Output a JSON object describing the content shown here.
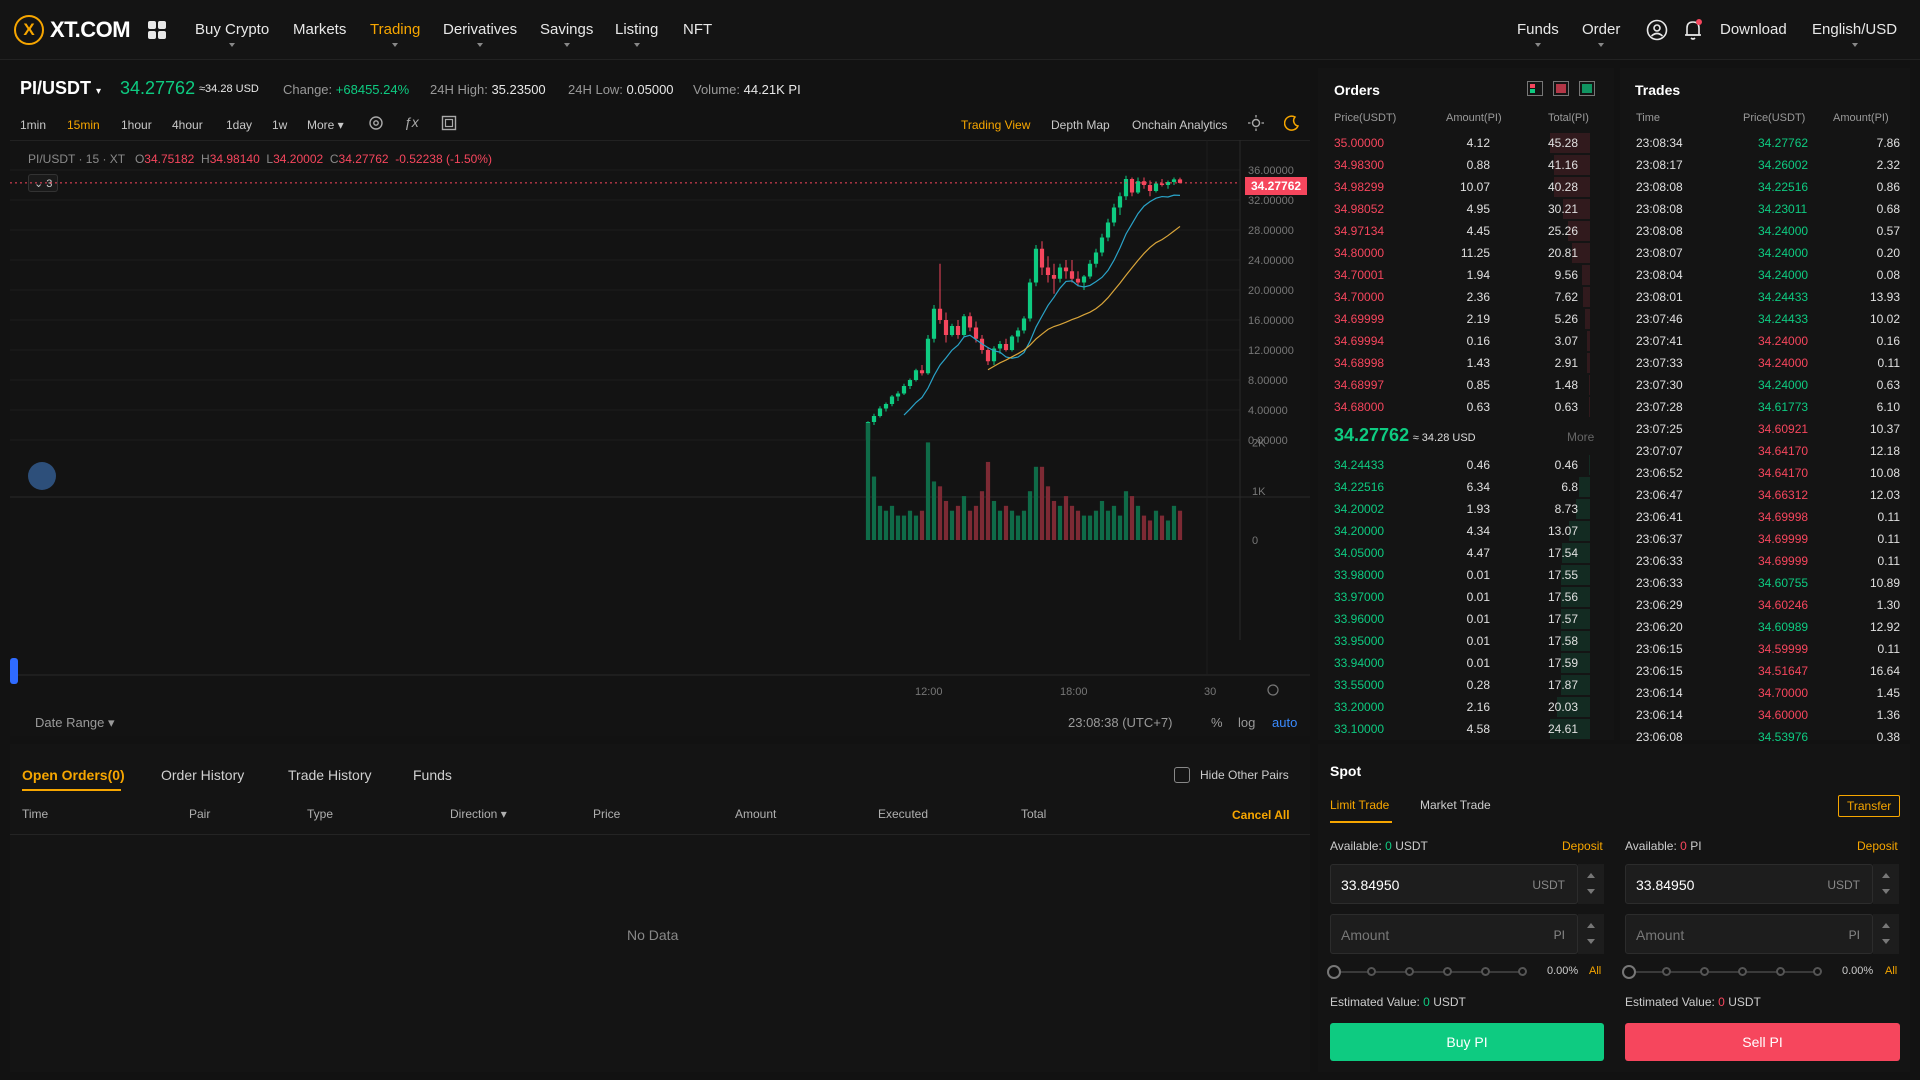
{
  "brand": {
    "logo_text": "XT.COM",
    "logo_mark": "X"
  },
  "nav": {
    "items": [
      "Buy Crypto",
      "Markets",
      "Trading",
      "Derivatives",
      "Savings",
      "Listing",
      "NFT"
    ],
    "right": {
      "funds": "Funds",
      "order": "Order",
      "download": "Download",
      "language": "English/USD"
    }
  },
  "ticker": {
    "pair": "PI/USDT",
    "price": "34.27762",
    "price_usd": "≈34.28 USD",
    "change_label": "Change:",
    "change_value": "+68455.24%",
    "high_label": "24H High:",
    "high_value": "35.23500",
    "low_label": "24H Low:",
    "low_value": "0.05000",
    "volume_label": "Volume:",
    "volume_value": "44.21K PI"
  },
  "timeframes": [
    "1min",
    "15min",
    "1hour",
    "4hour",
    "1day",
    "1w",
    "More"
  ],
  "active_timeframe": "15min",
  "views": [
    "Trading View",
    "Depth Map",
    "Onchain Analytics"
  ],
  "active_view": "Trading View",
  "chart_legend": {
    "symbol": "PI/USDT · 15 · XT",
    "o_label": "O",
    "o": "34.75182",
    "h_label": "H",
    "h": "34.98140",
    "l_label": "L",
    "l": "34.20002",
    "c_label": "C",
    "c": "34.27762",
    "chg": "-0.52238 (-1.50%)",
    "indicator_count": "3",
    "last_price_tag": "34.27762"
  },
  "chart_data": {
    "type": "candlestick",
    "price_axis": [
      "36.00000",
      "32.00000",
      "28.00000",
      "24.00000",
      "20.00000",
      "16.00000",
      "12.00000",
      "8.00000",
      "4.00000",
      "0.00000"
    ],
    "volume_axis": [
      "2K",
      "1K",
      "0"
    ],
    "time_axis": [
      "12:00",
      "18:00",
      "30"
    ],
    "ylim": [
      0,
      36
    ],
    "candles": [
      [
        0.05,
        2.5,
        0.05,
        2.4
      ],
      [
        2.4,
        3.5,
        2.0,
        3.2
      ],
      [
        3.2,
        4.5,
        3.0,
        4.2
      ],
      [
        4.2,
        5.0,
        3.8,
        4.8
      ],
      [
        4.8,
        6.0,
        4.5,
        5.8
      ],
      [
        5.8,
        6.5,
        5.2,
        6.2
      ],
      [
        6.2,
        7.5,
        6.0,
        7.2
      ],
      [
        7.2,
        8.2,
        6.8,
        8.0
      ],
      [
        8.0,
        9.5,
        7.8,
        9.3
      ],
      [
        9.3,
        10.0,
        8.6,
        8.9
      ],
      [
        8.9,
        14.0,
        8.7,
        13.5
      ],
      [
        13.5,
        18.0,
        13.0,
        17.5
      ],
      [
        17.5,
        23.5,
        15.5,
        16.0
      ],
      [
        16.0,
        17.0,
        13.0,
        14.0
      ],
      [
        14.0,
        15.5,
        13.8,
        15.2
      ],
      [
        15.2,
        16.0,
        13.5,
        14.0
      ],
      [
        14.0,
        16.8,
        13.8,
        16.5
      ],
      [
        16.5,
        17.0,
        14.5,
        15.0
      ],
      [
        15.0,
        15.8,
        13.0,
        13.5
      ],
      [
        13.5,
        14.0,
        11.5,
        12.0
      ],
      [
        12.0,
        12.4,
        10.0,
        10.5
      ],
      [
        10.5,
        12.5,
        10.0,
        12.2
      ],
      [
        12.2,
        13.2,
        11.5,
        12.8
      ],
      [
        12.8,
        13.5,
        11.8,
        12.0
      ],
      [
        12.0,
        14.0,
        11.8,
        13.8
      ],
      [
        13.8,
        15.0,
        13.0,
        14.6
      ],
      [
        14.6,
        16.5,
        14.2,
        16.2
      ],
      [
        16.2,
        21.5,
        15.8,
        21.0
      ],
      [
        21.0,
        26.0,
        20.5,
        25.5
      ],
      [
        25.5,
        26.5,
        22.0,
        23.0
      ],
      [
        23.0,
        24.5,
        21.0,
        22.0
      ],
      [
        22.0,
        23.5,
        19.5,
        21.5
      ],
      [
        21.5,
        23.5,
        21.0,
        23.0
      ],
      [
        23.0,
        24.0,
        21.5,
        22.5
      ],
      [
        22.5,
        24.0,
        21.0,
        21.5
      ],
      [
        21.5,
        22.5,
        20.5,
        21.0
      ],
      [
        21.0,
        22.0,
        20.0,
        21.8
      ],
      [
        21.8,
        24.0,
        21.5,
        23.5
      ],
      [
        23.5,
        25.5,
        23.0,
        25.0
      ],
      [
        25.0,
        27.5,
        24.5,
        27.0
      ],
      [
        27.0,
        29.5,
        26.5,
        29.0
      ],
      [
        29.0,
        31.5,
        28.5,
        31.0
      ],
      [
        31.0,
        33.0,
        30.0,
        32.5
      ],
      [
        32.5,
        35.235,
        32.0,
        34.8
      ],
      [
        34.8,
        35.0,
        32.5,
        33.0
      ],
      [
        33.0,
        35.0,
        32.8,
        34.5
      ],
      [
        34.5,
        35.0,
        33.5,
        34.0
      ],
      [
        34.0,
        34.6,
        32.5,
        33.2
      ],
      [
        33.2,
        34.5,
        33.0,
        34.2
      ],
      [
        34.2,
        34.8,
        33.8,
        34.0
      ],
      [
        34.0,
        34.6,
        33.5,
        34.4
      ],
      [
        34.4,
        35.0,
        34.0,
        34.75
      ],
      [
        34.75,
        34.98,
        34.2,
        34.27762
      ]
    ],
    "volumes": [
      2.4,
      1.3,
      0.7,
      0.6,
      0.7,
      0.5,
      0.5,
      0.6,
      0.5,
      0.6,
      2.0,
      1.2,
      1.1,
      0.8,
      0.6,
      0.7,
      0.9,
      0.6,
      0.7,
      1.0,
      1.6,
      0.8,
      0.6,
      0.7,
      0.6,
      0.5,
      0.6,
      1.0,
      1.5,
      1.5,
      1.1,
      0.8,
      0.7,
      0.9,
      0.7,
      0.6,
      0.5,
      0.5,
      0.6,
      0.8,
      0.6,
      0.7,
      0.5,
      1.0,
      0.9,
      0.7,
      0.5,
      0.4,
      0.6,
      0.5,
      0.4,
      0.7,
      0.6
    ]
  },
  "chart_footer": {
    "date_range": "Date Range",
    "clock": "23:08:38 (UTC+7)",
    "pct": "%",
    "log": "log",
    "auto": "auto"
  },
  "orders": {
    "title": "Orders",
    "headers": [
      "Price(USDT)",
      "Amount(PI)",
      "Total(PI)"
    ],
    "asks": [
      [
        "35.00000",
        "4.12",
        "45.28"
      ],
      [
        "34.98300",
        "0.88",
        "41.16"
      ],
      [
        "34.98299",
        "10.07",
        "40.28"
      ],
      [
        "34.98052",
        "4.95",
        "30.21"
      ],
      [
        "34.97134",
        "4.45",
        "25.26"
      ],
      [
        "34.80000",
        "11.25",
        "20.81"
      ],
      [
        "34.70001",
        "1.94",
        "9.56"
      ],
      [
        "34.70000",
        "2.36",
        "7.62"
      ],
      [
        "34.69999",
        "2.19",
        "5.26"
      ],
      [
        "34.69994",
        "0.16",
        "3.07"
      ],
      [
        "34.68998",
        "1.43",
        "2.91"
      ],
      [
        "34.68997",
        "0.85",
        "1.48"
      ],
      [
        "34.68000",
        "0.63",
        "0.63"
      ]
    ],
    "last_price": "34.27762",
    "last_price_usd": "≈ 34.28 USD",
    "more": "More",
    "bids": [
      [
        "34.24433",
        "0.46",
        "0.46"
      ],
      [
        "34.22516",
        "6.34",
        "6.8"
      ],
      [
        "34.20002",
        "1.93",
        "8.73"
      ],
      [
        "34.20000",
        "4.34",
        "13.07"
      ],
      [
        "34.05000",
        "4.47",
        "17.54"
      ],
      [
        "33.98000",
        "0.01",
        "17.55"
      ],
      [
        "33.97000",
        "0.01",
        "17.56"
      ],
      [
        "33.96000",
        "0.01",
        "17.57"
      ],
      [
        "33.95000",
        "0.01",
        "17.58"
      ],
      [
        "33.94000",
        "0.01",
        "17.59"
      ],
      [
        "33.55000",
        "0.28",
        "17.87"
      ],
      [
        "33.20000",
        "2.16",
        "20.03"
      ],
      [
        "33.10000",
        "4.58",
        "24.61"
      ]
    ]
  },
  "trades": {
    "title": "Trades",
    "headers": [
      "Time",
      "Price(USDT)",
      "Amount(PI)"
    ],
    "rows": [
      [
        "23:08:34",
        "34.27762",
        "7.86",
        "buy"
      ],
      [
        "23:08:17",
        "34.26002",
        "2.32",
        "buy"
      ],
      [
        "23:08:08",
        "34.22516",
        "0.86",
        "buy"
      ],
      [
        "23:08:08",
        "34.23011",
        "0.68",
        "buy"
      ],
      [
        "23:08:08",
        "34.24000",
        "0.57",
        "buy"
      ],
      [
        "23:08:07",
        "34.24000",
        "0.20",
        "buy"
      ],
      [
        "23:08:04",
        "34.24000",
        "0.08",
        "buy"
      ],
      [
        "23:08:01",
        "34.24433",
        "13.93",
        "buy"
      ],
      [
        "23:07:46",
        "34.24433",
        "10.02",
        "buy"
      ],
      [
        "23:07:41",
        "34.24000",
        "0.16",
        "sell"
      ],
      [
        "23:07:33",
        "34.24000",
        "0.11",
        "sell"
      ],
      [
        "23:07:30",
        "34.24000",
        "0.63",
        "buy"
      ],
      [
        "23:07:28",
        "34.61773",
        "6.10",
        "buy"
      ],
      [
        "23:07:25",
        "34.60921",
        "10.37",
        "sell"
      ],
      [
        "23:07:07",
        "34.64170",
        "12.18",
        "sell"
      ],
      [
        "23:06:52",
        "34.64170",
        "10.08",
        "sell"
      ],
      [
        "23:06:47",
        "34.66312",
        "12.03",
        "sell"
      ],
      [
        "23:06:41",
        "34.69998",
        "0.11",
        "sell"
      ],
      [
        "23:06:37",
        "34.69999",
        "0.11",
        "sell"
      ],
      [
        "23:06:33",
        "34.69999",
        "0.11",
        "sell"
      ],
      [
        "23:06:33",
        "34.60755",
        "10.89",
        "buy"
      ],
      [
        "23:06:29",
        "34.60246",
        "1.30",
        "sell"
      ],
      [
        "23:06:20",
        "34.60989",
        "12.92",
        "buy"
      ],
      [
        "23:06:15",
        "34.59999",
        "0.11",
        "sell"
      ],
      [
        "23:06:15",
        "34.51647",
        "16.64",
        "sell"
      ],
      [
        "23:06:14",
        "34.70000",
        "1.45",
        "sell"
      ],
      [
        "23:06:14",
        "34.60000",
        "1.36",
        "sell"
      ],
      [
        "23:06:08",
        "34.53976",
        "0.38",
        "buy"
      ]
    ]
  },
  "bottom": {
    "tabs": [
      "Open Orders(0)",
      "Order History",
      "Trade History",
      "Funds"
    ],
    "hide_pairs": "Hide Other Pairs",
    "columns": [
      "Time",
      "Pair",
      "Type",
      "Direction",
      "Price",
      "Amount",
      "Executed",
      "Total"
    ],
    "cancel_all": "Cancel All",
    "empty": "No Data"
  },
  "spot": {
    "title": "Spot",
    "tabs": [
      "Limit Trade",
      "Market Trade"
    ],
    "transfer": "Transfer",
    "buy": {
      "available_label": "Available:",
      "available_value": "0",
      "available_unit": "USDT",
      "deposit": "Deposit",
      "price": "33.84950",
      "price_unit": "USDT",
      "amount_placeholder": "Amount",
      "amount_unit": "PI",
      "pct": "0.00%",
      "all": "All",
      "est_label": "Estimated Value:",
      "est_value": "0",
      "est_unit": "USDT",
      "button": "Buy PI"
    },
    "sell": {
      "available_label": "Available:",
      "available_value": "0",
      "available_unit": "PI",
      "deposit": "Deposit",
      "price": "33.84950",
      "price_unit": "USDT",
      "amount_placeholder": "Amount",
      "amount_unit": "PI",
      "pct": "0.00%",
      "all": "All",
      "est_label": "Estimated Value:",
      "est_value": "0",
      "est_unit": "USDT",
      "button": "Sell PI"
    }
  },
  "colors": {
    "accent": "#f7a600",
    "up": "#0ecb81",
    "down": "#f6465d",
    "bg": "#121212"
  }
}
